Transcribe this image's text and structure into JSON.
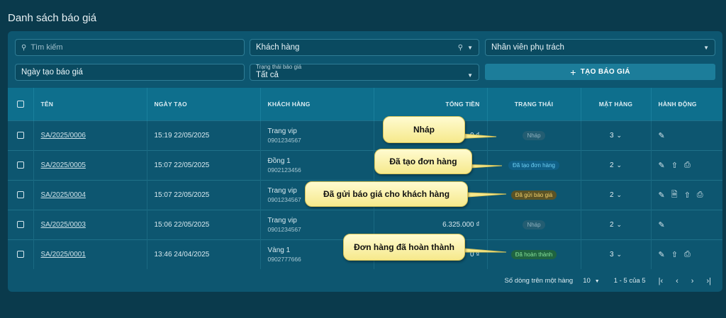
{
  "page": {
    "title": "Danh sách báo giá"
  },
  "filters": {
    "search_placeholder": "Tìm kiếm",
    "customer_label": "Khách hàng",
    "staff_label": "Nhân viên phụ trách",
    "date_label": "Ngày tạo báo giá",
    "status_legend": "Trạng thái báo giá",
    "status_value": "Tất cả",
    "create_button": "TẠO BÁO GIÁ"
  },
  "table": {
    "headers": {
      "name": "TÊN",
      "created": "NGÀY TẠO",
      "customer": "KHÁCH HÀNG",
      "total": "TỔNG TIỀN",
      "status": "TRẠNG THÁI",
      "items": "MẶT HÀNG",
      "actions": "HÀNH ĐỘNG"
    },
    "rows": [
      {
        "code": "SA/2025/0006",
        "created": "15:19 22/05/2025",
        "customer": "Trang vip",
        "phone": "0901234567",
        "total": "0 ₫",
        "status": "Nháp",
        "qty": "3"
      },
      {
        "code": "SA/2025/0005",
        "created": "15:07 22/05/2025",
        "customer": "Đồng 1",
        "phone": "0902123456",
        "total": "",
        "status": "Đã tạo đơn hàng",
        "qty": "2"
      },
      {
        "code": "SA/2025/0004",
        "created": "15:07 22/05/2025",
        "customer": "Trang vip",
        "phone": "0901234567",
        "total": "",
        "status": "Đã gửi báo giá",
        "qty": "2"
      },
      {
        "code": "SA/2025/0003",
        "created": "15:06 22/05/2025",
        "customer": "Trang vip",
        "phone": "0901234567",
        "total": "6.325.000 ₫",
        "status": "Nháp",
        "qty": "2"
      },
      {
        "code": "SA/2025/0001",
        "created": "13:46 24/04/2025",
        "customer": "Vàng 1",
        "phone": "0902777666",
        "total": "0 ₫",
        "status": "Đã hoàn thành",
        "qty": "3"
      }
    ]
  },
  "footer": {
    "rows_per_page_label": "Số dòng trên một hàng",
    "rows_per_page": "10",
    "range": "1 - 5 của 5",
    "first": "|‹",
    "prev": "‹",
    "next": "›",
    "last": "›|"
  },
  "callouts": {
    "draft": "Nháp",
    "order_created": "Đã tạo đơn hàng",
    "sent": "Đã gửi báo giá cho khách hàng",
    "completed": "Đơn hàng đã hoàn thành"
  },
  "colors": {
    "background": "#0a3a4c",
    "panel": "#0d5670",
    "header": "#0e6f8d",
    "accent_button": "#1c7d9a",
    "callout": "#fff7b0"
  }
}
